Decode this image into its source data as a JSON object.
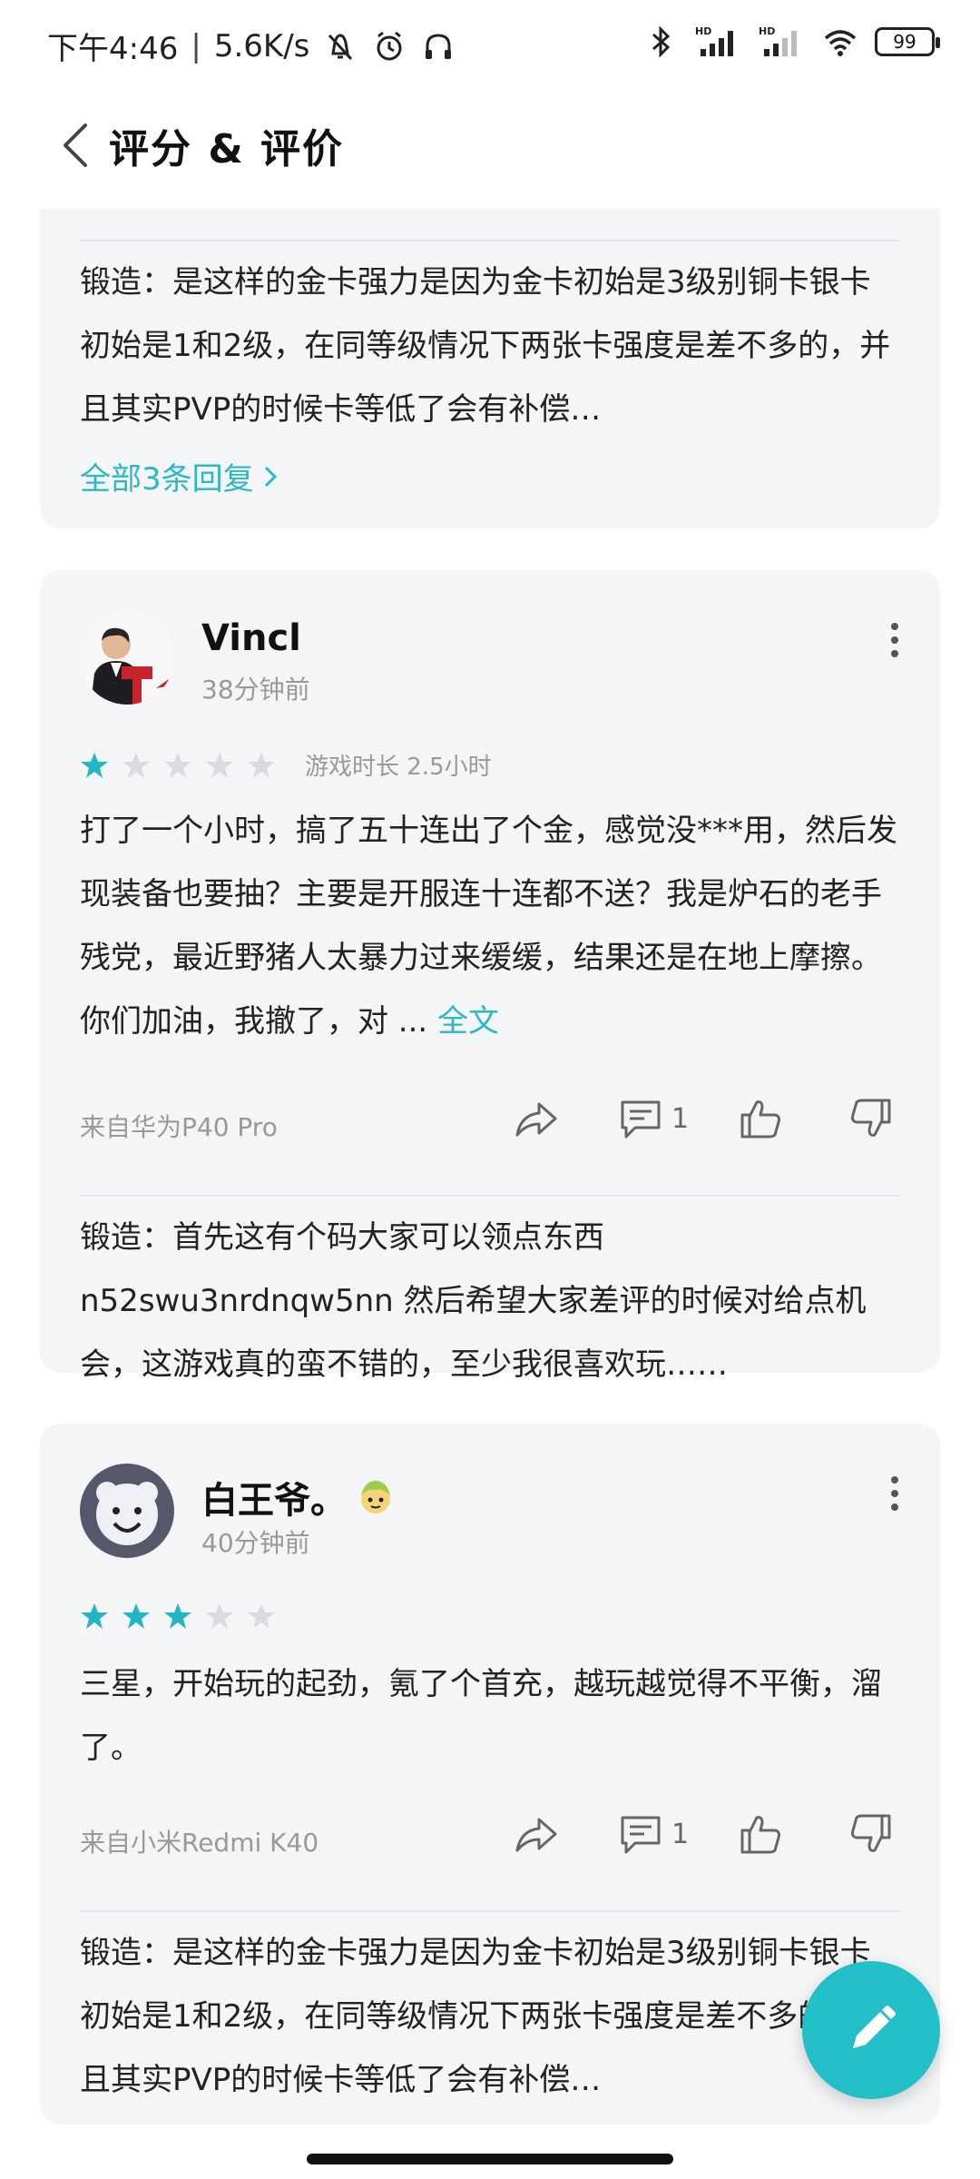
{
  "status_bar": {
    "time": "下午4:46",
    "speed": "5.6K/s",
    "battery": "99",
    "left_icons": [
      "mute-icon",
      "alarm-icon",
      "headset-icon"
    ],
    "right_icons": [
      "bluetooth-icon",
      "signal-hd-icon",
      "signal-hd-icon",
      "wifi-icon",
      "battery-icon"
    ]
  },
  "header": {
    "title": "评分 & 评价"
  },
  "reviews": [
    {
      "reply": {
        "text": "锻造：是这样的金卡强力是因为金卡初始是3级别铜卡银卡初始是1和2级，在同等级情况下两张卡强度是差不多的，并且其实PVP的时候卡等低了会有补偿…",
        "more_label": "全部3条回复"
      }
    },
    {
      "username": "Vincl",
      "time": "38分钟前",
      "rating": 1,
      "max_rating": 5,
      "playtime": "游戏时长 2.5小时",
      "text": "打了一个小时，搞了五十连出了个金，感觉没***用，然后发现装备也要抽？主要是开服连十连都不送？我是炉石的老手残党，最近野猪人太暴力过来缓缓，结果还是在地上摩擦。你们加油，我撤了，对 ...",
      "full_text_label": "全文",
      "device": "来自华为P40 Pro",
      "comment_count": "1",
      "reply": {
        "text": "锻造：首先这有个码大家可以领点东西n52swu3nrdnqw5nn 然后希望大家差评的时候对给点机会，这游戏真的蛮不错的，至少我很喜欢玩……"
      }
    },
    {
      "username": "白王爷。",
      "time": "40分钟前",
      "rating": 3,
      "max_rating": 5,
      "text": "三星，开始玩的起劲，氪了个首充，越玩越觉得不平衡，溜了。",
      "device": "来自小米Redmi K40",
      "comment_count": "1",
      "reply": {
        "text": "锻造：是这样的金卡强力是因为金卡初始是3级别铜卡银卡初始是1和2级，在同等级情况下两张卡强度是差不多的，并且其实PVP的时候卡等低了会有补偿…"
      }
    }
  ],
  "colors": {
    "accent": "#2bb8c4",
    "star_on": "#23b6c4",
    "star_off": "#d9dbde",
    "card_bg": "#f4f5f7"
  },
  "fab_icon": "pencil-icon"
}
